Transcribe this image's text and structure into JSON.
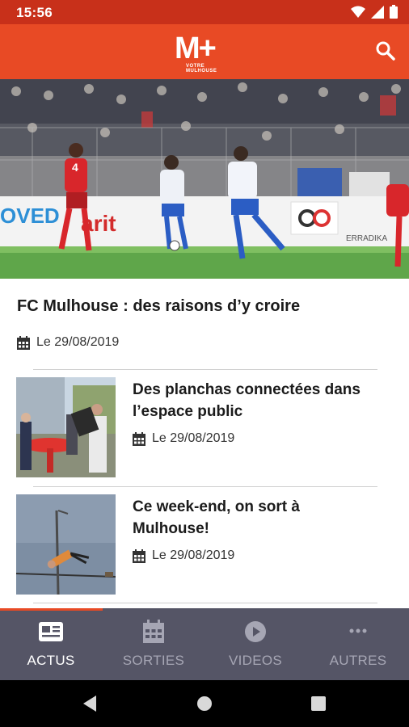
{
  "status_bar": {
    "time": "15:56"
  },
  "app_bar": {
    "logo_text": "M+",
    "logo_tagline": "VOTRE MULHOUSE"
  },
  "feature": {
    "title": "FC Mulhouse : des raisons d’y croire",
    "date": "Le 29/08/2019"
  },
  "articles": [
    {
      "title": "Des planchas connectées dans l’espace public",
      "date": "Le 29/08/2019"
    },
    {
      "title": "Ce week-end, on sort à Mulhouse!",
      "date": "Le 29/08/2019"
    }
  ],
  "nav": {
    "items": [
      {
        "label": "ACTUS",
        "icon": "news-icon",
        "active": true
      },
      {
        "label": "SORTIES",
        "icon": "calendar-icon",
        "active": false
      },
      {
        "label": "VIDEOS",
        "icon": "play-icon",
        "active": false
      },
      {
        "label": "AUTRES",
        "icon": "more-icon",
        "active": false
      }
    ]
  },
  "colors": {
    "brand": "#e84a25",
    "status_bar": "#c8301a",
    "nav_bg": "#555566"
  }
}
